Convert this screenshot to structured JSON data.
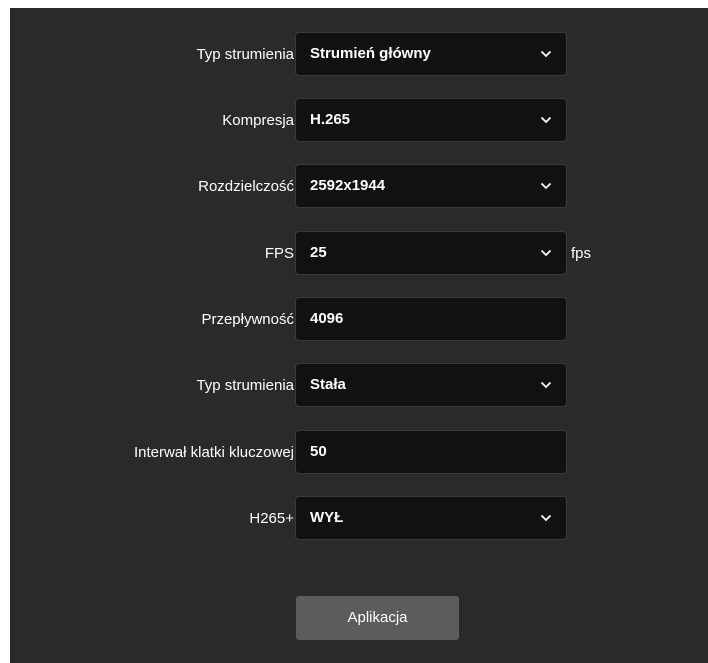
{
  "form": {
    "rows": [
      {
        "label": "Typ strumienia",
        "value": "Strumień główny",
        "kind": "select"
      },
      {
        "label": "Kompresja",
        "value": "H.265",
        "kind": "select"
      },
      {
        "label": "Rozdzielczość",
        "value": "2592x1944",
        "kind": "select"
      },
      {
        "label": "FPS",
        "value": "25",
        "kind": "select",
        "unit": "fps"
      },
      {
        "label": "Przepływność",
        "value": "4096",
        "kind": "input"
      },
      {
        "label": "Typ strumienia",
        "value": "Stała",
        "kind": "select"
      },
      {
        "label": "Interwał klatki kluczowej",
        "value": "50",
        "kind": "input"
      },
      {
        "label": "H265+",
        "value": "WYŁ",
        "kind": "select"
      }
    ],
    "apply_label": "Aplikacja"
  },
  "icons": {
    "dropdown": "chevron-down-icon"
  },
  "colors": {
    "panel_bg": "#2a2a2a",
    "field_bg": "#111111",
    "button_bg": "#5c5c5c",
    "text": "#ffffff"
  }
}
